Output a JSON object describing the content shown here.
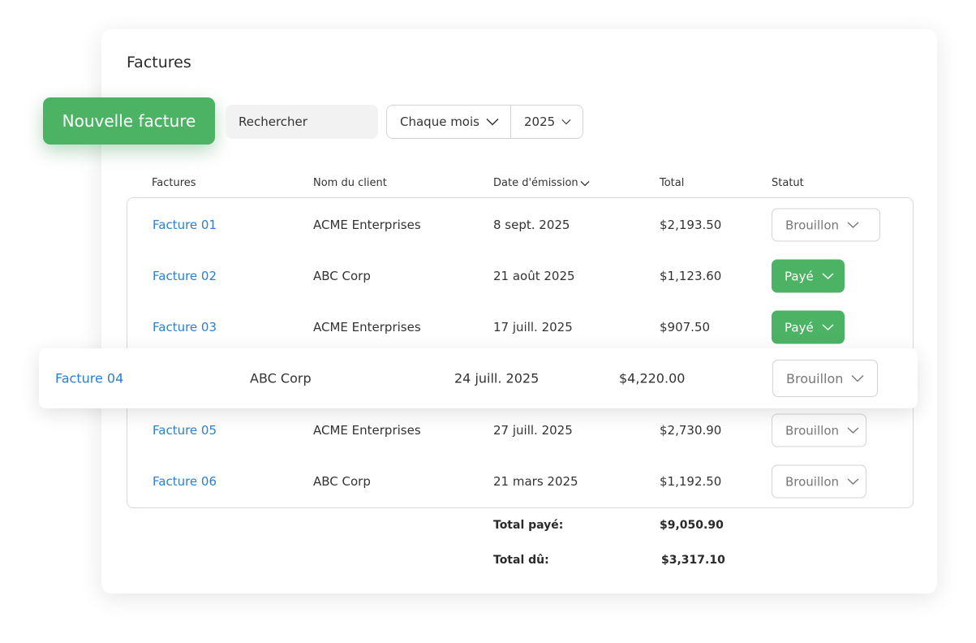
{
  "page": {
    "title": "Factures"
  },
  "toolbar": {
    "new_invoice_label": "Nouvelle facture",
    "search_placeholder": "Rechercher",
    "period_label": "Chaque mois",
    "year_label": "2025"
  },
  "columns": {
    "invoice": "Factures",
    "client": "Nom du client",
    "date": "Date d'émission",
    "total": "Total",
    "status": "Statut"
  },
  "rows": [
    {
      "invoice": "Facture 01",
      "client": "ACME Enterprises",
      "date": "8 sept. 2025",
      "total": "$2,193.50",
      "status": "Brouillon",
      "status_type": "draft"
    },
    {
      "invoice": "Facture 02",
      "client": "ABC Corp",
      "date": "21 août 2025",
      "total": "$1,123.60",
      "status": "Payé",
      "status_type": "paid"
    },
    {
      "invoice": "Facture 03",
      "client": "ACME Enterprises",
      "date": "17 juill. 2025",
      "total": "$907.50",
      "status": "Payé",
      "status_type": "paid"
    },
    {
      "invoice": "Facture 04",
      "client": "ABC Corp",
      "date": "24 juill. 2025",
      "total": "$4,220.00",
      "status": "Brouillon",
      "status_type": "draft"
    },
    {
      "invoice": "Facture 05",
      "client": "ACME Enterprises",
      "date": "27 juill. 2025",
      "total": "$2,730.90",
      "status": "Brouillon",
      "status_type": "draft"
    },
    {
      "invoice": "Facture 06",
      "client": "ABC Corp",
      "date": "21 mars 2025",
      "total": "$1,192.50",
      "status": "Brouillon",
      "status_type": "draft"
    }
  ],
  "summary": {
    "paid_label": "Total payé:",
    "paid_value": "$9,050.90",
    "due_label": "Total dû:",
    "due_value": "$3,317.10"
  },
  "colors": {
    "accent_green": "#4cb365",
    "link_blue": "#2b7fd4"
  },
  "icons": {
    "dropdown": "chevron-down-icon",
    "sort": "chevron-down-icon"
  }
}
